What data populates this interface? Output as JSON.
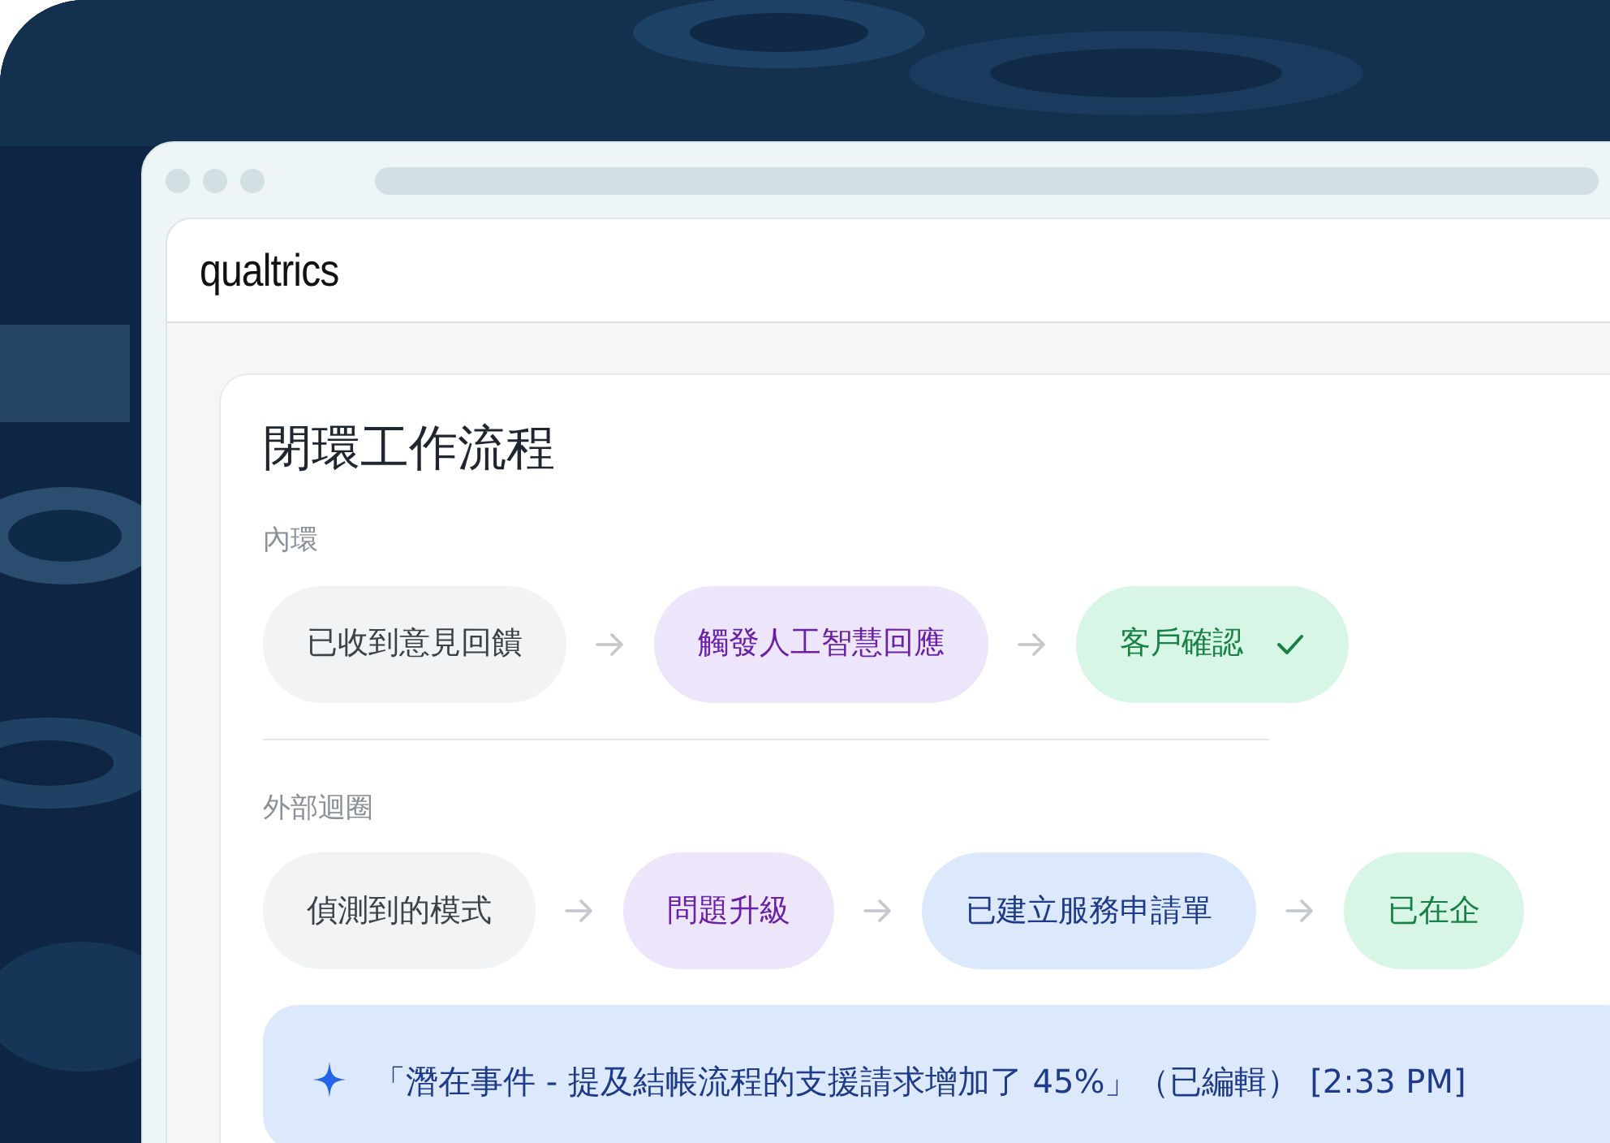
{
  "brand": "qualtrics",
  "card": {
    "title": "閉環工作流程",
    "sections": [
      {
        "label": "內環",
        "steps": [
          {
            "label": "已收到意見回饋",
            "kind": "neutral",
            "checked": false
          },
          {
            "label": "觸發人工智慧回應",
            "kind": "ai",
            "checked": false
          },
          {
            "label": "客戶確認",
            "kind": "done",
            "checked": true
          }
        ]
      },
      {
        "label": "外部迴圈",
        "steps": [
          {
            "label": "偵測到的模式",
            "kind": "neutral",
            "checked": false
          },
          {
            "label": "問題升級",
            "kind": "ai",
            "checked": false
          },
          {
            "label": "已建立服務申請單",
            "kind": "ticket",
            "checked": false
          },
          {
            "label": "已在企",
            "kind": "done",
            "checked": false
          }
        ]
      }
    ],
    "insight": "「潛在事件 - 提及結帳流程的支援請求增加了 45%」（已編輯） [2:33 PM]"
  }
}
